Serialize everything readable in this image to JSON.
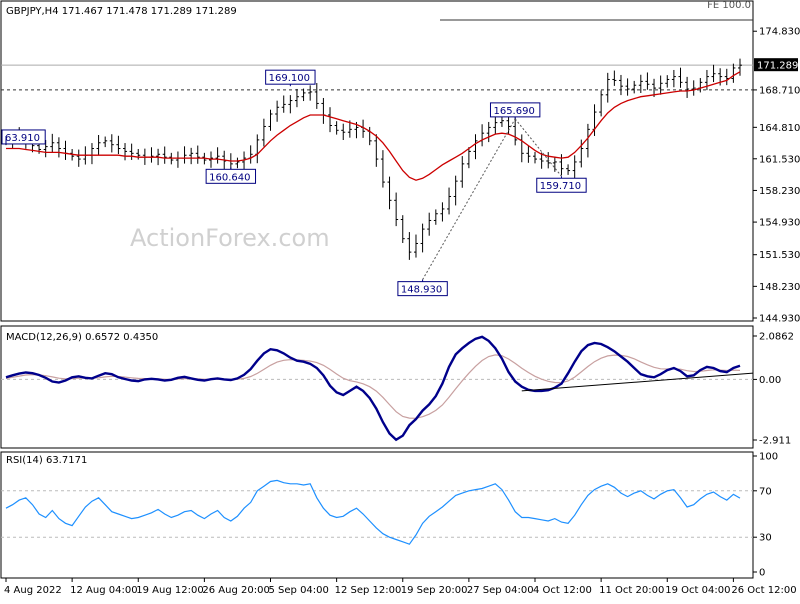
{
  "chart_data": [
    {
      "panel": "price",
      "type": "candlestick",
      "header": "GBPJPY,H4  171.467 171.478 171.289 171.289",
      "symbol": "GBPJPY",
      "timeframe": "H4",
      "ohlc": {
        "open": 171.467,
        "high": 171.478,
        "low": 171.289,
        "close": 171.289
      },
      "watermark": "ActionForex.com",
      "fe_label": "FE 100.0",
      "ylim": [
        144.93,
        176.0
      ],
      "y_ticks": [
        "174.830",
        "171.289",
        "168.710",
        "164.810",
        "161.530",
        "158.230",
        "154.930",
        "151.530",
        "148.230",
        "144.930"
      ],
      "tick_values": [
        174.83,
        171.289,
        168.71,
        164.81,
        161.53,
        158.23,
        154.93,
        151.53,
        148.23,
        144.93
      ],
      "last_price": 171.289,
      "level_line": 168.71,
      "fe_level": 176.0,
      "annotations": [
        {
          "label": "63.910",
          "value": 163.91,
          "x": 0
        },
        {
          "label": "169.100",
          "value": 169.1,
          "x": 43
        },
        {
          "label": "160.640",
          "value": 160.64,
          "x": 34
        },
        {
          "label": "148.930",
          "value": 148.93,
          "x": 63
        },
        {
          "label": "165.690",
          "value": 165.69,
          "x": 77
        },
        {
          "label": "159.710",
          "value": 159.71,
          "x": 84
        }
      ],
      "close_series": [
        163.4,
        163.8,
        163.9,
        163.5,
        162.9,
        162.5,
        162.8,
        163.2,
        162.6,
        162.1,
        161.8,
        161.5,
        161.9,
        162.6,
        163.2,
        163.4,
        163.0,
        162.6,
        162.3,
        162.1,
        161.9,
        161.7,
        161.8,
        162.0,
        161.7,
        161.4,
        161.6,
        161.9,
        162.1,
        161.7,
        161.4,
        161.6,
        161.8,
        161.3,
        161.0,
        161.2,
        161.6,
        162.0,
        163.5,
        164.9,
        166.2,
        166.9,
        167.2,
        167.6,
        168.0,
        168.4,
        168.5,
        167.3,
        166.1,
        165.0,
        164.5,
        164.3,
        164.6,
        164.8,
        164.4,
        163.4,
        161.5,
        159.1,
        157.2,
        155.2,
        153.2,
        151.8,
        152.7,
        154.2,
        155.1,
        155.8,
        156.3,
        157.6,
        159.2,
        161.0,
        162.3,
        163.4,
        164.2,
        164.8,
        165.3,
        165.5,
        164.9,
        163.5,
        162.1,
        161.8,
        161.5,
        161.3,
        161.1,
        161.2,
        160.5,
        160.3,
        161.2,
        162.6,
        164.6,
        166.4,
        168.2,
        169.8,
        169.7,
        169.1,
        168.8,
        169.2,
        169.6,
        169.3,
        168.9,
        169.4,
        169.8,
        170.1,
        169.5,
        168.8,
        168.9,
        169.5,
        170.1,
        170.4,
        170.1,
        169.9,
        171.0,
        171.289
      ],
      "ma_series": [
        162.6,
        162.6,
        162.6,
        162.5,
        162.4,
        162.3,
        162.2,
        162.2,
        162.2,
        162.1,
        162.0,
        161.9,
        161.9,
        161.9,
        161.9,
        161.9,
        161.9,
        161.9,
        161.8,
        161.8,
        161.7,
        161.7,
        161.7,
        161.7,
        161.6,
        161.6,
        161.6,
        161.6,
        161.6,
        161.6,
        161.6,
        161.5,
        161.5,
        161.4,
        161.3,
        161.3,
        161.4,
        161.6,
        162.0,
        162.7,
        163.4,
        164.0,
        164.5,
        165.0,
        165.4,
        165.8,
        166.1,
        166.1,
        166.1,
        165.9,
        165.7,
        165.5,
        165.3,
        165.1,
        164.8,
        164.4,
        163.9,
        163.2,
        162.3,
        161.3,
        160.3,
        159.6,
        159.3,
        159.5,
        159.9,
        160.4,
        160.9,
        161.3,
        161.7,
        162.1,
        162.6,
        163.1,
        163.5,
        163.8,
        164.1,
        164.2,
        164.1,
        163.8,
        163.4,
        162.9,
        162.4,
        162.0,
        161.8,
        161.7,
        161.6,
        161.7,
        162.2,
        162.9,
        163.7,
        164.6,
        165.5,
        166.3,
        166.9,
        167.3,
        167.6,
        167.8,
        168.0,
        168.1,
        168.2,
        168.3,
        168.4,
        168.5,
        168.6,
        168.6,
        168.7,
        168.9,
        169.1,
        169.3,
        169.5,
        169.7,
        170.2,
        170.6
      ],
      "highlight_segment": {
        "from_index": 63,
        "to_index": 78
      }
    },
    {
      "panel": "macd",
      "type": "line",
      "header": "MACD(12,26,9) 0.6572 0.4350",
      "name": "MACD(12,26,9)",
      "current_values": {
        "macd": 0.6572,
        "signal": 0.435
      },
      "ylim": [
        -2.911,
        2.0862
      ],
      "y_ticks": [
        "2.0862",
        "0.00",
        "-2.911"
      ],
      "tick_values": [
        2.0862,
        0.0,
        -2.911
      ],
      "macd_series": [
        0.1,
        0.2,
        0.28,
        0.33,
        0.3,
        0.21,
        0.08,
        -0.1,
        -0.15,
        -0.05,
        0.1,
        0.15,
        0.08,
        0.05,
        0.18,
        0.3,
        0.25,
        0.1,
        0.02,
        -0.05,
        -0.08,
        0.0,
        0.03,
        0.0,
        -0.05,
        -0.02,
        0.08,
        0.12,
        0.05,
        -0.02,
        -0.05,
        0.01,
        0.05,
        0.0,
        -0.03,
        0.05,
        0.22,
        0.5,
        0.9,
        1.25,
        1.45,
        1.4,
        1.25,
        1.05,
        0.9,
        0.85,
        0.75,
        0.55,
        0.2,
        -0.3,
        -0.62,
        -0.75,
        -0.55,
        -0.35,
        -0.55,
        -0.9,
        -1.4,
        -2.05,
        -2.6,
        -2.9,
        -2.7,
        -2.2,
        -1.9,
        -1.5,
        -1.2,
        -0.8,
        -0.2,
        0.6,
        1.2,
        1.5,
        1.75,
        1.95,
        2.05,
        1.85,
        1.5,
        1.0,
        0.35,
        -0.1,
        -0.35,
        -0.5,
        -0.55,
        -0.55,
        -0.52,
        -0.4,
        -0.2,
        0.3,
        0.85,
        1.35,
        1.65,
        1.75,
        1.7,
        1.55,
        1.35,
        1.1,
        0.85,
        0.55,
        0.25,
        0.15,
        0.1,
        0.25,
        0.45,
        0.55,
        0.4,
        0.15,
        0.2,
        0.45,
        0.6,
        0.55,
        0.4,
        0.35,
        0.55,
        0.6572
      ],
      "signal_series": [
        0.05,
        0.1,
        0.16,
        0.21,
        0.23,
        0.22,
        0.18,
        0.12,
        0.06,
        0.03,
        0.04,
        0.06,
        0.06,
        0.06,
        0.08,
        0.12,
        0.15,
        0.14,
        0.11,
        0.08,
        0.05,
        0.04,
        0.04,
        0.03,
        0.01,
        0.0,
        0.02,
        0.04,
        0.04,
        0.03,
        0.01,
        0.01,
        0.02,
        0.01,
        0.0,
        0.01,
        0.05,
        0.14,
        0.29,
        0.48,
        0.68,
        0.83,
        0.92,
        0.95,
        0.94,
        0.92,
        0.88,
        0.81,
        0.68,
        0.48,
        0.26,
        0.06,
        -0.06,
        -0.12,
        -0.21,
        -0.35,
        -0.56,
        -0.86,
        -1.21,
        -1.55,
        -1.78,
        -1.86,
        -1.87,
        -1.79,
        -1.67,
        -1.49,
        -1.23,
        -0.86,
        -0.45,
        -0.06,
        0.3,
        0.63,
        0.91,
        1.1,
        1.18,
        1.14,
        0.98,
        0.77,
        0.54,
        0.33,
        0.15,
        0.01,
        -0.09,
        -0.15,
        -0.16,
        -0.07,
        0.11,
        0.36,
        0.62,
        0.85,
        1.02,
        1.13,
        1.17,
        1.16,
        1.1,
        0.99,
        0.84,
        0.7,
        0.58,
        0.51,
        0.5,
        0.51,
        0.49,
        0.42,
        0.38,
        0.39,
        0.43,
        0.46,
        0.45,
        0.43,
        0.45,
        0.435
      ],
      "trendline": {
        "from": {
          "index": 78,
          "value": -0.55
        },
        "to": {
          "index": 111,
          "value": 0.3
        }
      }
    },
    {
      "panel": "rsi",
      "type": "line",
      "header": "RSI(14) 63.7171",
      "name": "RSI(14)",
      "current_value": 63.7171,
      "ylim": [
        0,
        100
      ],
      "y_ticks": [
        "100",
        "70",
        "30",
        "0"
      ],
      "tick_values": [
        100,
        70,
        30,
        0
      ],
      "levels": [
        70,
        30
      ],
      "rsi_series": [
        55,
        58,
        62,
        64,
        58,
        50,
        47,
        53,
        46,
        42,
        40,
        48,
        56,
        61,
        64,
        58,
        52,
        50,
        48,
        46,
        47,
        49,
        51,
        54,
        50,
        47,
        49,
        52,
        53,
        49,
        46,
        50,
        53,
        47,
        44,
        48,
        55,
        60,
        70,
        74,
        78,
        79,
        77,
        76,
        76,
        75,
        76,
        64,
        55,
        49,
        47,
        48,
        52,
        55,
        50,
        44,
        38,
        33,
        30,
        28,
        26,
        24,
        32,
        42,
        48,
        52,
        56,
        61,
        66,
        68,
        70,
        71,
        72,
        74,
        76,
        71,
        62,
        52,
        47,
        47,
        46,
        45,
        44,
        46,
        43,
        42,
        49,
        58,
        66,
        71,
        74,
        76,
        73,
        68,
        65,
        68,
        70,
        66,
        63,
        67,
        70,
        71,
        64,
        56,
        58,
        63,
        67,
        69,
        65,
        62,
        67,
        63.7171
      ]
    }
  ],
  "x_axis": {
    "labels": [
      "4 Aug 2022",
      "12 Aug 04:00",
      "19 Aug 12:00",
      "26 Aug 20:00",
      "5 Sep 04:00",
      "12 Sep 12:00",
      "19 Sep 20:00",
      "27 Sep 04:00",
      "4 Oct 12:00",
      "11 Oct 20:00",
      "19 Oct 04:00",
      "26 Oct 12:00"
    ],
    "label_indices": [
      0,
      10,
      20,
      30,
      40,
      50,
      60,
      70,
      80,
      90,
      100,
      110
    ]
  },
  "colors": {
    "background": "#ffffff",
    "candle": "#000000",
    "ma": "#cc0000",
    "macd": "#00008b",
    "signal": "#c8a0a0",
    "grid_dash": "#bbbbbb",
    "price_label_bg": "#000000",
    "label_border": "#000080",
    "watermark": "#d0d0d0",
    "zigzag": "#555555"
  }
}
